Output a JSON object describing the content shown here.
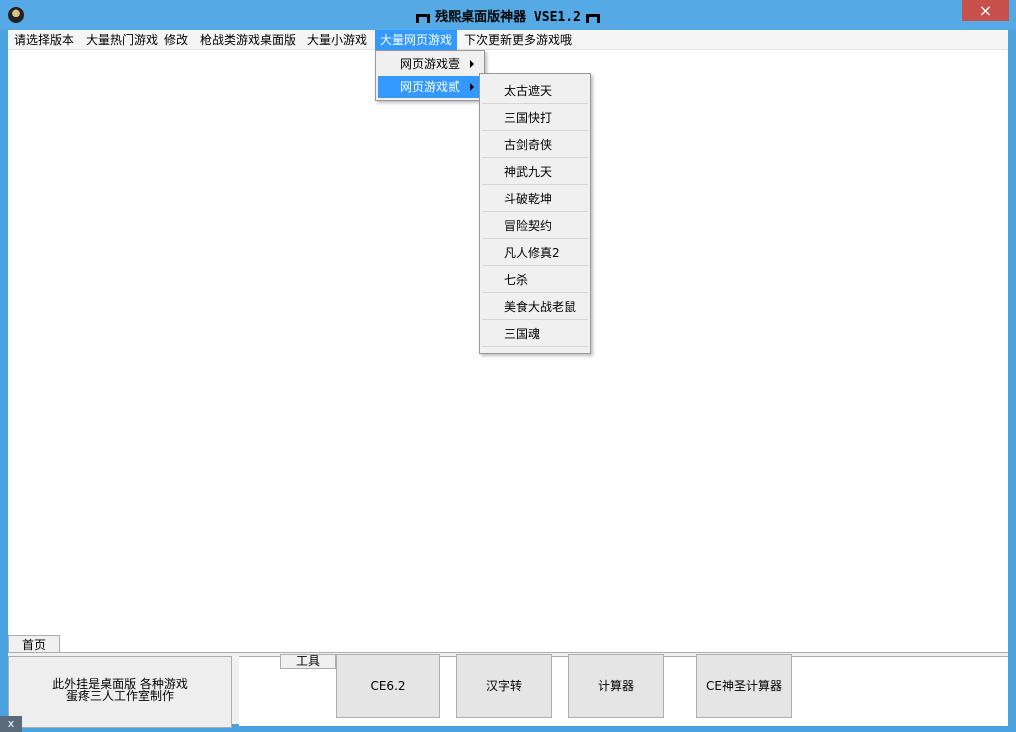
{
  "window": {
    "title": "残熙桌面版神器 VSE1.2",
    "close_glyph": "×"
  },
  "menubar": {
    "items": [
      {
        "label": "请选择版本"
      },
      {
        "label": "大量热门游戏"
      },
      {
        "label": "修改"
      },
      {
        "label": "枪战类游戏桌面版"
      },
      {
        "label": "大量小游戏"
      },
      {
        "label": "大量网页游戏",
        "active": true
      },
      {
        "label": "下次更新更多游戏哦"
      }
    ]
  },
  "submenu": {
    "items": [
      {
        "label": "网页游戏壹"
      },
      {
        "label": "网页游戏贰",
        "highlighted": true
      }
    ]
  },
  "games_menu": {
    "items": [
      {
        "label": "太古遮天"
      },
      {
        "label": "三国快打"
      },
      {
        "label": "古剑奇侠"
      },
      {
        "label": "神武九天"
      },
      {
        "label": "斗破乾坤"
      },
      {
        "label": "冒险契约"
      },
      {
        "label": "凡人修真2"
      },
      {
        "label": "七杀"
      },
      {
        "label": "美食大战老鼠"
      },
      {
        "label": "三国魂"
      }
    ]
  },
  "bottom": {
    "home_tab": "首页",
    "info_line1": "此外挂是桌面版 各种游戏",
    "info_line2": "蛋疼三人工作室制作",
    "tools_tab": "工具",
    "tool_buttons": [
      {
        "label": "CE6.2"
      },
      {
        "label": "汉字转"
      },
      {
        "label": "计算器"
      },
      {
        "label": "CE神圣计算器"
      }
    ]
  },
  "taskbar": {
    "corner_glyph": "x"
  },
  "colors": {
    "titlebar": "#55a9e4",
    "close": "#c7504b",
    "highlight": "#3399ff"
  }
}
